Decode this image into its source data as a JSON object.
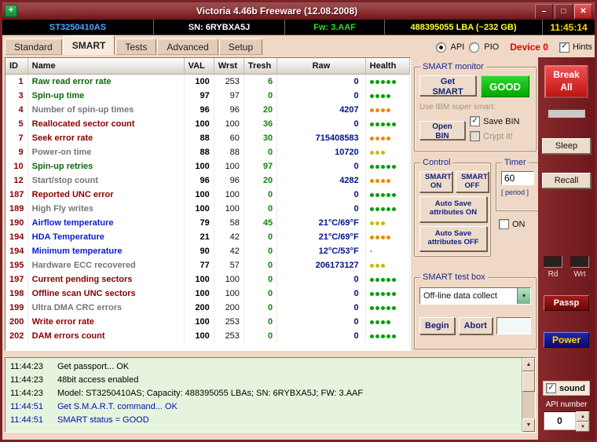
{
  "window": {
    "title": "Victoria 4.46b Freeware (12.08.2008)"
  },
  "icons": {
    "app": "+",
    "minimize": "–",
    "maximize": "□",
    "close": "✕",
    "check": "✓",
    "dropdown": "▼",
    "up": "▲",
    "down": "▼"
  },
  "infobar": {
    "model": "ST3250410AS",
    "serial": "SN: 6RYBXA5J",
    "firmware": "Fw: 3.AAF",
    "capacity": "488395055 LBA (~232 GB)",
    "clock": "11:45:14"
  },
  "tabs": [
    {
      "label": "Standard"
    },
    {
      "label": "SMART",
      "active": true
    },
    {
      "label": "Tests"
    },
    {
      "label": "Advanced"
    },
    {
      "label": "Setup"
    }
  ],
  "mode": {
    "api": "API",
    "pio": "PIO",
    "device": "Device 0",
    "hints": "Hints"
  },
  "smart_table": {
    "headers": [
      "ID",
      "Name",
      "VAL",
      "Wrst",
      "Tresh",
      "Raw",
      "Health"
    ],
    "rows": [
      {
        "id": "1",
        "name": "Raw read error rate",
        "name_color": "green",
        "val": "100",
        "wrst": "253",
        "tresh": "6",
        "raw": "0",
        "health": {
          "dots": 5,
          "color": "green"
        }
      },
      {
        "id": "3",
        "name": "Spin-up time",
        "name_color": "green",
        "val": "97",
        "wrst": "97",
        "tresh": "0",
        "raw": "0",
        "health": {
          "dots": 4,
          "color": "green"
        }
      },
      {
        "id": "4",
        "name": "Number of spin-up times",
        "name_color": "gray",
        "val": "96",
        "wrst": "96",
        "tresh": "20",
        "raw": "4207",
        "health": {
          "dots": 4,
          "color": "orange"
        }
      },
      {
        "id": "5",
        "name": "Reallocated sector count",
        "name_color": "maroon",
        "val": "100",
        "wrst": "100",
        "tresh": "36",
        "raw": "0",
        "health": {
          "dots": 5,
          "color": "green"
        }
      },
      {
        "id": "7",
        "name": "Seek error rate",
        "name_color": "maroon",
        "val": "88",
        "wrst": "60",
        "tresh": "30",
        "raw": "715408583",
        "health": {
          "dots": 4,
          "color": "orange"
        }
      },
      {
        "id": "9",
        "name": "Power-on time",
        "name_color": "gray",
        "val": "88",
        "wrst": "88",
        "tresh": "0",
        "raw": "10720",
        "health": {
          "dots": 3,
          "color": "yellow"
        }
      },
      {
        "id": "10",
        "name": "Spin-up retries",
        "name_color": "green",
        "val": "100",
        "wrst": "100",
        "tresh": "97",
        "raw": "0",
        "health": {
          "dots": 5,
          "color": "green"
        }
      },
      {
        "id": "12",
        "name": "Start/stop count",
        "name_color": "gray",
        "val": "96",
        "wrst": "96",
        "tresh": "20",
        "raw": "4282",
        "health": {
          "dots": 4,
          "color": "orange"
        }
      },
      {
        "id": "187",
        "name": "Reported UNC error",
        "name_color": "maroon",
        "val": "100",
        "wrst": "100",
        "tresh": "0",
        "raw": "0",
        "health": {
          "dots": 5,
          "color": "green"
        }
      },
      {
        "id": "189",
        "name": "High Fly writes",
        "name_color": "gray",
        "val": "100",
        "wrst": "100",
        "tresh": "0",
        "raw": "0",
        "health": {
          "dots": 5,
          "color": "green"
        }
      },
      {
        "id": "190",
        "name": "Airflow temperature",
        "name_color": "blue",
        "val": "79",
        "wrst": "58",
        "tresh": "45",
        "raw": "21°C/69°F",
        "health": {
          "dots": 3,
          "color": "yellow"
        }
      },
      {
        "id": "194",
        "name": "HDA Temperature",
        "name_color": "blue",
        "val": "21",
        "wrst": "42",
        "tresh": "0",
        "raw": "21°C/69°F",
        "health": {
          "dots": 4,
          "color": "orange"
        }
      },
      {
        "id": "194",
        "name": "Minimum temperature",
        "name_color": "blue",
        "val": "90",
        "wrst": "42",
        "tresh": "0",
        "raw": "12°C/53°F",
        "health": {
          "dash": "-"
        }
      },
      {
        "id": "195",
        "name": "Hardware ECC recovered",
        "name_color": "gray",
        "val": "77",
        "wrst": "57",
        "tresh": "0",
        "raw": "206173127",
        "health": {
          "dots": 3,
          "color": "yellow"
        }
      },
      {
        "id": "197",
        "name": "Current pending sectors",
        "name_color": "maroon",
        "val": "100",
        "wrst": "100",
        "tresh": "0",
        "raw": "0",
        "health": {
          "dots": 5,
          "color": "green"
        }
      },
      {
        "id": "198",
        "name": "Offline scan UNC sectors",
        "name_color": "maroon",
        "val": "100",
        "wrst": "100",
        "tresh": "0",
        "raw": "0",
        "health": {
          "dots": 5,
          "color": "green"
        }
      },
      {
        "id": "199",
        "name": "Ultra DMA CRC errors",
        "name_color": "gray",
        "val": "200",
        "wrst": "200",
        "tresh": "0",
        "raw": "0",
        "health": {
          "dots": 5,
          "color": "green"
        }
      },
      {
        "id": "200",
        "name": "Write error rate",
        "name_color": "maroon",
        "val": "100",
        "wrst": "253",
        "tresh": "0",
        "raw": "0",
        "health": {
          "dots": 4,
          "color": "green"
        }
      },
      {
        "id": "202",
        "name": "DAM errors count",
        "name_color": "maroon",
        "val": "100",
        "wrst": "253",
        "tresh": "0",
        "raw": "0",
        "health": {
          "dots": 5,
          "color": "green"
        }
      }
    ]
  },
  "panels": {
    "smart_monitor": {
      "title": "SMART monitor",
      "get_smart": "Get SMART",
      "status": "GOOD",
      "use_ibm": "Use IBM super smart:",
      "save_bin": "Save BIN",
      "open_bin": "Open BIN",
      "crypt_it": "Crypt it!"
    },
    "control": {
      "title": "Control",
      "smart_on": "SMART ON",
      "smart_off": "SMART OFF",
      "autosave_on": "Auto Save attributes ON",
      "autosave_off": "Auto Save attributes OFF"
    },
    "timer": {
      "title": "Timer",
      "value": "60",
      "period": "[ period ]",
      "on": "ON"
    },
    "test_box": {
      "title": "SMART test box",
      "selected": "Off-line data collect",
      "begin": "Begin",
      "abort": "Abort",
      "aux": ""
    }
  },
  "right_column": {
    "break_all": "Break All",
    "sleep": "Sleep",
    "recall": "Recall",
    "rd": "Rd",
    "wrt": "Wrt",
    "passp": "Passp",
    "power": "Power",
    "sound": "sound",
    "api_number": "API number",
    "api_value": "0"
  },
  "log": {
    "lines": [
      {
        "time": "11:44:23",
        "text": "Get passport... OK",
        "color": "black"
      },
      {
        "time": "11:44:23",
        "text": "48bit access enabled",
        "color": "black"
      },
      {
        "time": "11:44:23",
        "text": "Model: ST3250410AS; Capacity: 488395055 LBAs; SN: 6RYBXA5J; FW: 3.AAF",
        "color": "black"
      },
      {
        "time": "11:44:51",
        "text": "Get S.M.A.R.T. command... OK",
        "color": "blue"
      },
      {
        "time": "11:44:51",
        "text": "SMART status = GOOD",
        "color": "blue"
      }
    ]
  },
  "colors": {
    "status_good": "#00A800",
    "break_red": "#C01414",
    "passp_red": "#6E0606",
    "power_navy": "#0A0C6E",
    "frame_maroon": "#7B2125",
    "dot_green": "#00A000",
    "dot_orange": "#E88A00",
    "dot_yellow": "#C9BC00"
  }
}
